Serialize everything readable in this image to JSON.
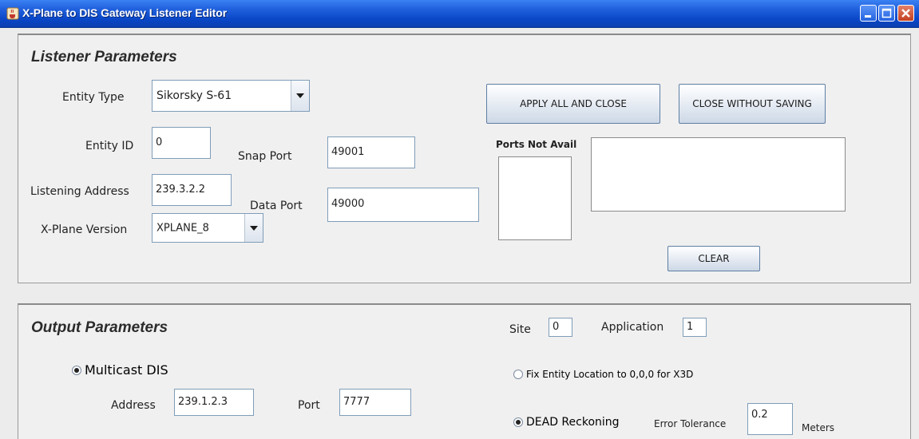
{
  "window": {
    "title": "X-Plane to DIS Gateway Listener Editor",
    "app_icon": "java-cup-icon",
    "controls": [
      "minimize-icon",
      "maximize-icon",
      "close-icon"
    ]
  },
  "listener": {
    "section_title": "Listener Parameters",
    "entity_type": {
      "label": "Entity Type",
      "value": "Sikorsky S-61"
    },
    "entity_id": {
      "label": "Entity ID",
      "value": "0"
    },
    "listening_address": {
      "label": "Listening Address",
      "value": "239.3.2.2"
    },
    "xplane_version": {
      "label": "X-Plane Version",
      "value": "XPLANE_8"
    },
    "snap_port": {
      "label": "Snap Port",
      "value": "49001"
    },
    "data_port": {
      "label": "Data Port",
      "value": "49000"
    },
    "ports_not_avail_label": "Ports Not Avail",
    "apply_button": "APPLY ALL AND CLOSE",
    "close_button": "CLOSE WITHOUT SAVING",
    "clear_button": "CLEAR"
  },
  "output": {
    "section_title": "Output Parameters",
    "site": {
      "label": "Site",
      "value": "0"
    },
    "application": {
      "label": "Application",
      "value": "1"
    },
    "multicast": {
      "label": "Multicast DIS",
      "selected": true
    },
    "address": {
      "label": "Address",
      "value": "239.1.2.3"
    },
    "port": {
      "label": "Port",
      "value": "7777"
    },
    "fix_entity": {
      "label": "Fix Entity Location to 0,0,0 for X3D",
      "selected": false
    },
    "dead_reckoning": {
      "label": "DEAD Reckoning",
      "selected": true
    },
    "error_tolerance": {
      "label": "Error Tolerance",
      "value": "0.2",
      "unit": "Meters"
    }
  },
  "colors": {
    "titlebar": "#0a47c8",
    "panel_bg": "#f0f0f0",
    "field_border": "#7f9db9"
  }
}
